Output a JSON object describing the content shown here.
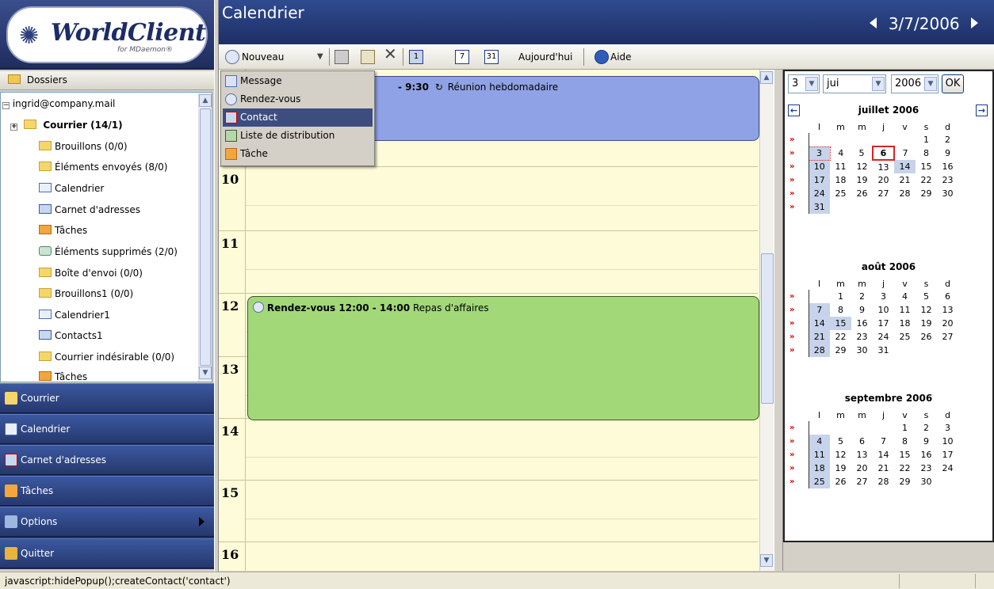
{
  "app": {
    "brand": "WorldClient",
    "brand_sub": "for MDaemon®"
  },
  "sidebar": {
    "header": "Dossiers",
    "account": "ingrid@company.mail",
    "folders": [
      {
        "label": "Courrier (14/1)",
        "icon": "mail-envelope-icon"
      },
      {
        "label": "Brouillons (0/0)",
        "icon": "drafts-envelope-icon"
      },
      {
        "label": "Éléments envoyés (8/0)",
        "icon": "sent-envelope-icon"
      },
      {
        "label": "Calendrier",
        "icon": "calendar-icon"
      },
      {
        "label": "Carnet d'adresses",
        "icon": "address-book-icon"
      },
      {
        "label": "Tâches",
        "icon": "tasks-icon"
      },
      {
        "label": "Éléments supprimés (2/0)",
        "icon": "trash-icon"
      },
      {
        "label": "Boîte d'envoi (0/0)",
        "icon": "outbox-envelope-icon"
      },
      {
        "label": "Brouillons1 (0/0)",
        "icon": "drafts-envelope-icon"
      },
      {
        "label": "Calendrier1",
        "icon": "calendar-icon"
      },
      {
        "label": "Contacts1",
        "icon": "address-book-icon"
      },
      {
        "label": "Courrier indésirable (0/0)",
        "icon": "junk-envelope-icon"
      },
      {
        "label": "Tâches",
        "icon": "tasks-icon"
      }
    ],
    "nav": [
      {
        "label": "Courrier"
      },
      {
        "label": "Calendrier"
      },
      {
        "label": "Carnet d'adresses"
      },
      {
        "label": "Tâches"
      },
      {
        "label": "Options"
      },
      {
        "label": "Quitter"
      }
    ]
  },
  "main": {
    "title": "Calendrier",
    "current_date": "3/7/2006",
    "toolbar": {
      "new_label": "Nouveau",
      "today_label": "Aujourd'hui",
      "help_label": "Aide"
    },
    "new_menu": [
      {
        "label": "Message"
      },
      {
        "label": "Rendez-vous"
      },
      {
        "label": "Contact"
      },
      {
        "label": "Liste de distribution"
      },
      {
        "label": "Tâche"
      }
    ],
    "hours": [
      "10",
      "11",
      "12",
      "13",
      "14",
      "15",
      "16"
    ],
    "events": [
      {
        "time": "- 9:30",
        "title": "Réunion hebdomadaire",
        "color": "#8fa2e6"
      },
      {
        "time": "Rendez-vous 12:00 - 14:00",
        "title": "Repas d'affaires",
        "color": "#a3d879"
      }
    ]
  },
  "mini_calendar": {
    "day_select": "3",
    "month_select": "jui",
    "year_select": "2006",
    "ok_label": "OK",
    "weekday_headers": [
      "l",
      "m",
      "m",
      "j",
      "v",
      "s",
      "d"
    ],
    "week_marker": "»",
    "months": [
      {
        "title": "juillet 2006",
        "weeks": [
          [
            "",
            "",
            "",
            "",
            "",
            "1",
            "2"
          ],
          [
            "3",
            "4",
            "5",
            "6",
            "7",
            "8",
            "9"
          ],
          [
            "10",
            "11",
            "12",
            "13",
            "14",
            "15",
            "16"
          ],
          [
            "17",
            "18",
            "19",
            "20",
            "21",
            "22",
            "23"
          ],
          [
            "24",
            "25",
            "26",
            "27",
            "28",
            "29",
            "30"
          ],
          [
            "31",
            "",
            "",
            "",
            "",
            "",
            ""
          ]
        ]
      },
      {
        "title": "août 2006",
        "weeks": [
          [
            "",
            "1",
            "2",
            "3",
            "4",
            "5",
            "6"
          ],
          [
            "7",
            "8",
            "9",
            "10",
            "11",
            "12",
            "13"
          ],
          [
            "14",
            "15",
            "16",
            "17",
            "18",
            "19",
            "20"
          ],
          [
            "21",
            "22",
            "23",
            "24",
            "25",
            "26",
            "27"
          ],
          [
            "28",
            "29",
            "30",
            "31",
            "",
            "",
            ""
          ]
        ]
      },
      {
        "title": "septembre 2006",
        "weeks": [
          [
            "",
            "",
            "",
            "",
            "1",
            "2",
            "3"
          ],
          [
            "4",
            "5",
            "6",
            "7",
            "8",
            "9",
            "10"
          ],
          [
            "11",
            "12",
            "13",
            "14",
            "15",
            "16",
            "17"
          ],
          [
            "18",
            "19",
            "20",
            "21",
            "22",
            "23",
            "24"
          ],
          [
            "25",
            "26",
            "27",
            "28",
            "29",
            "30",
            ""
          ]
        ]
      }
    ]
  },
  "status_bar": {
    "text": "javascript:hidePopup();createContact('contact')"
  }
}
